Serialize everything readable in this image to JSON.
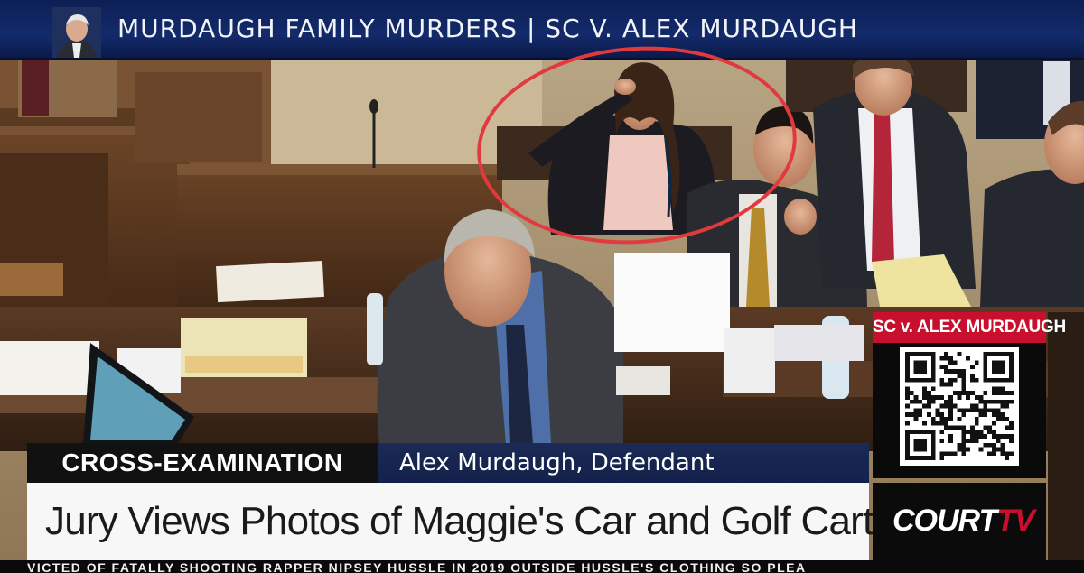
{
  "banner": {
    "title": "MURDAUGH FAMILY MURDERS  |  SC V. ALEX MURDAUGH"
  },
  "side_promo": {
    "title": "SC v. ALEX MURDAUGH",
    "qr_icon": "qr-code-icon"
  },
  "lower_third": {
    "label": "CROSS-EXAMINATION",
    "speaker": "Alex Murdaugh, Defendant",
    "headline": "Jury Views Photos of Maggie's Car and Golf Cart"
  },
  "logo": {
    "text_main": "COURT",
    "text_tv": "TV"
  },
  "ticker": {
    "text": "VICTED OF FATALLY SHOOTING RAPPER NIPSEY HUSSLE IN 2019 OUTSIDE HUSSLE'S CLOTHING SO PLEA"
  },
  "colors": {
    "banner_blue": "#132b6b",
    "highlight_red": "#e03a3e",
    "promo_red": "#c8102e",
    "headline_bg": "#f7f7f7"
  }
}
